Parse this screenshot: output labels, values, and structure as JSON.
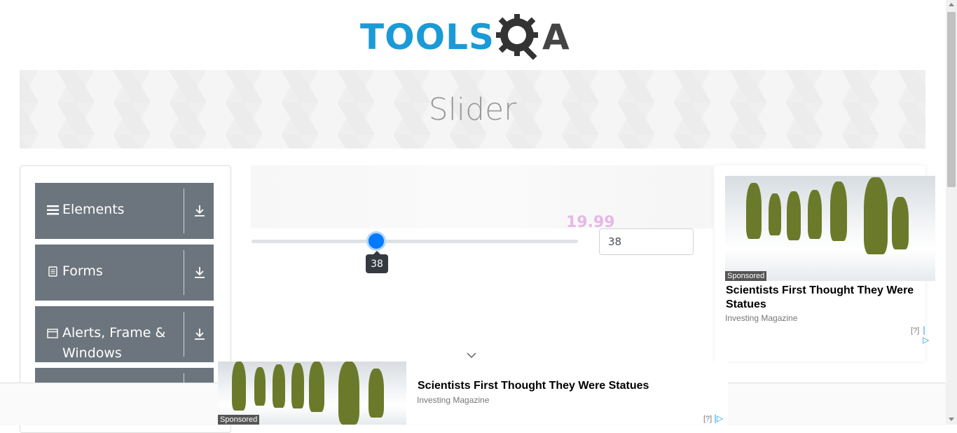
{
  "header": {
    "logo_text": "TOOLS",
    "logo_suffix": "A",
    "logo_gear_icon": "gear-magnifier-icon"
  },
  "banner": {
    "title": "Slider"
  },
  "sidebar": {
    "groups": [
      {
        "label": "Elements",
        "icon": "hamburger-icon",
        "arrow": "download-arrow-icon"
      },
      {
        "label": "Forms",
        "icon": "document-icon",
        "arrow": "download-arrow-icon"
      },
      {
        "label": "Alerts, Frame &",
        "label_line2": "Windows",
        "icon": "window-icon",
        "arrow": "download-arrow-icon"
      },
      {
        "label": "",
        "icon": "",
        "arrow": "download-arrow-icon"
      }
    ]
  },
  "slider": {
    "value": 38,
    "value_percent": 38,
    "tooltip": "38",
    "input_value": "38",
    "faint_overlay_text": "19.99"
  },
  "right_ad": {
    "badge": "Sponsored",
    "title": "Scientists First Thought They Were Statues",
    "source": "Investing Magazine",
    "info": "[?]"
  },
  "bottom_ad": {
    "badge": "Sponsored",
    "title": "Scientists First Thought They Were Statues",
    "source": "Investing Magazine",
    "info": "[?]"
  },
  "colors": {
    "accent": "#007bff",
    "nav_bg": "#6c757d",
    "logo_blue": "#1a9ad6",
    "logo_gray": "#444444"
  }
}
